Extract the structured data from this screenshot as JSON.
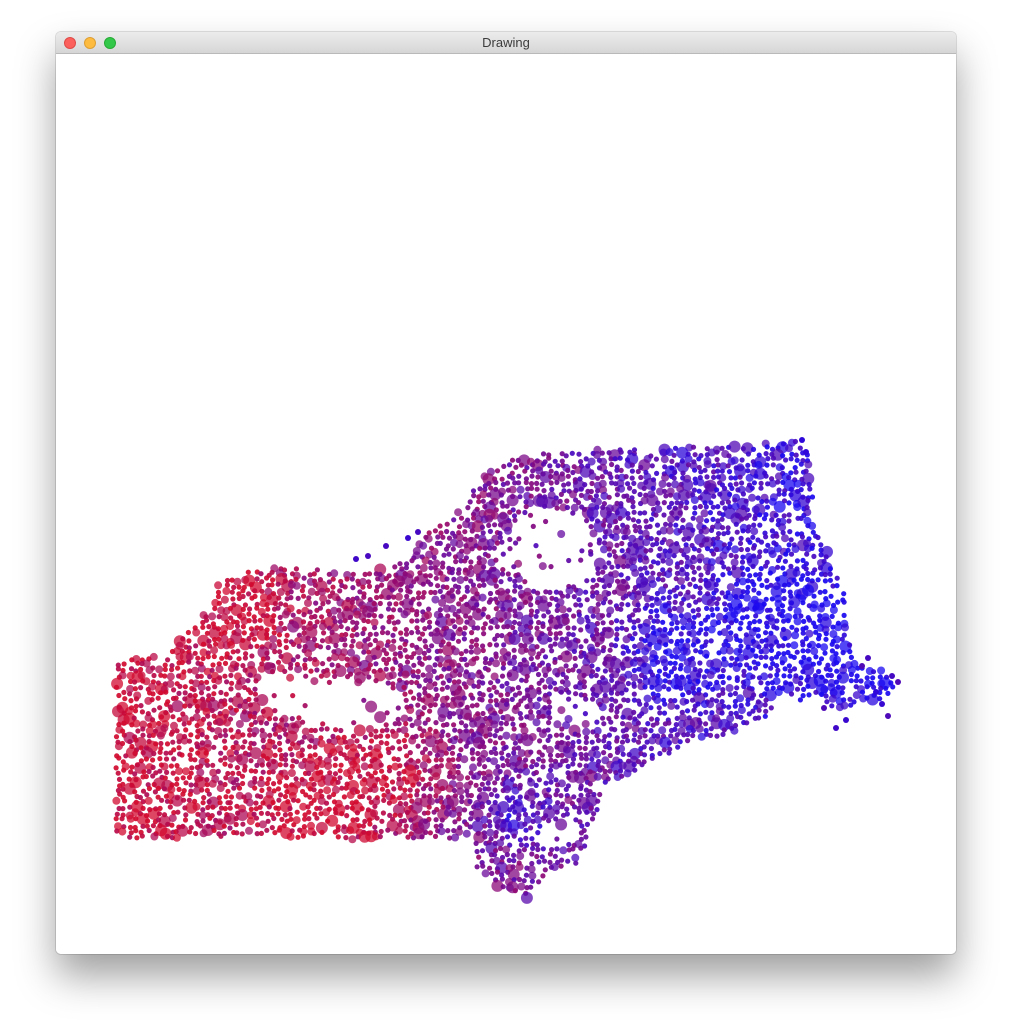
{
  "window": {
    "title": "Drawing",
    "buttons": {
      "close": "close",
      "minimize": "minimize",
      "zoom": "zoom"
    }
  },
  "canvas": {
    "background": "#ffffff",
    "point_color_range": [
      "#d10a2f",
      "#1a08f0"
    ],
    "description_icon": "map-scatter"
  }
}
